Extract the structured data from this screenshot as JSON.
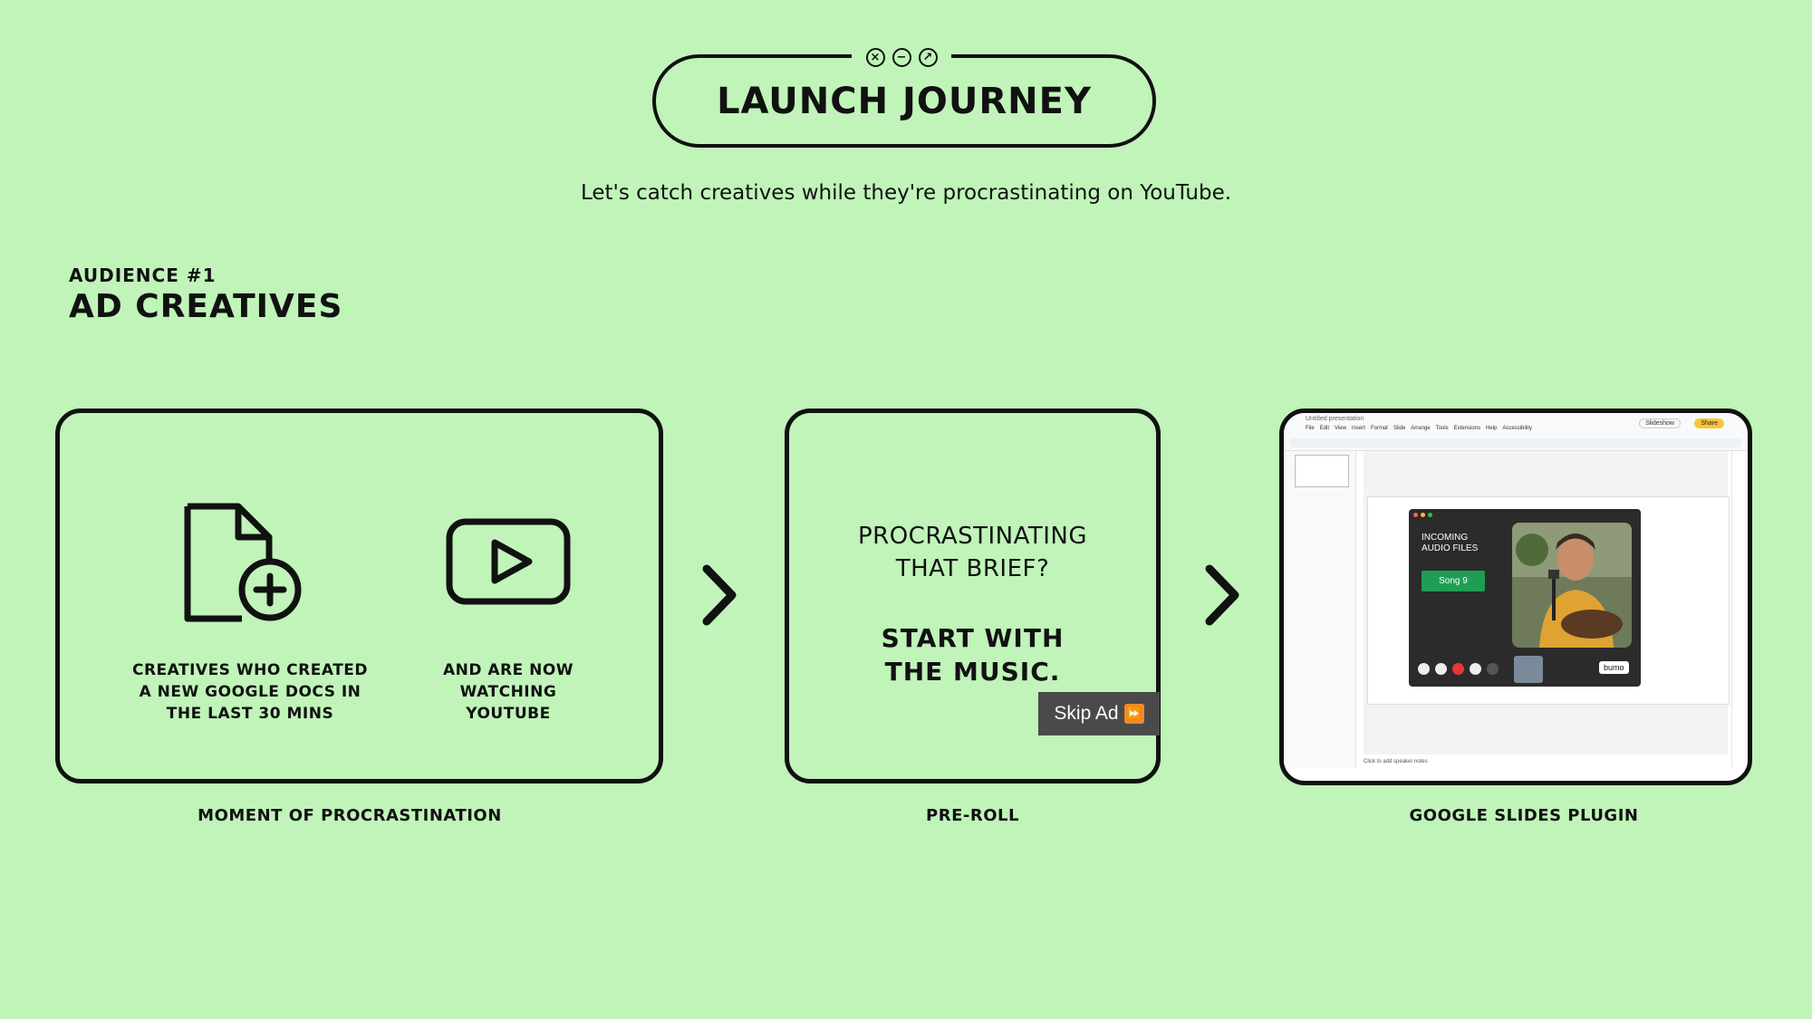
{
  "header": {
    "title": "LAUNCH JOURNEY",
    "subtitle": "Let's catch creatives while they're procrastinating on YouTube.",
    "window_controls": [
      "close-icon",
      "minimize-icon",
      "maximize-icon"
    ]
  },
  "audience": {
    "kicker": "AUDIENCE #1",
    "title": "AD CREATIVES"
  },
  "steps": [
    {
      "label": "MOMENT OF PROCRASTINATION",
      "items": [
        {
          "icon": "new-document-icon",
          "caption_lines": [
            "CREATIVES WHO CREATED",
            "A NEW GOOGLE DOCS IN",
            "THE LAST 30 MINS"
          ]
        },
        {
          "icon": "youtube-play-icon",
          "caption_lines": [
            "AND ARE NOW",
            "WATCHING",
            "YOUTUBE"
          ]
        }
      ]
    },
    {
      "label": "PRE-ROLL",
      "headline_lines": [
        "PROCRASTINATING",
        "THAT BRIEF?"
      ],
      "cta_lines": [
        "START WITH",
        "THE MUSIC."
      ],
      "skip_label": "Skip Ad"
    },
    {
      "label": "GOOGLE SLIDES PLUGIN",
      "screenshot": {
        "doc_title": "Untitled presentation",
        "menu": [
          "File",
          "Edit",
          "View",
          "Insert",
          "Format",
          "Slide",
          "Arrange",
          "Tools",
          "Extensions",
          "Help",
          "Accessibility"
        ],
        "slideshow_label": "Slideshow",
        "share_label": "Share",
        "notes_placeholder": "Click to add speaker notes",
        "plugin": {
          "heading_lines": [
            "INCOMING",
            "AUDIO FILES"
          ],
          "song_button": "Song 9",
          "brand": "bumo"
        }
      }
    }
  ],
  "colors": {
    "background": "#c0f4b9",
    "ink": "#111111",
    "skip_bg": "#4a4a4a",
    "skip_icon": "#f08a2b",
    "song_button": "#1f9d55",
    "plugin_bg": "#2b2b2b"
  }
}
